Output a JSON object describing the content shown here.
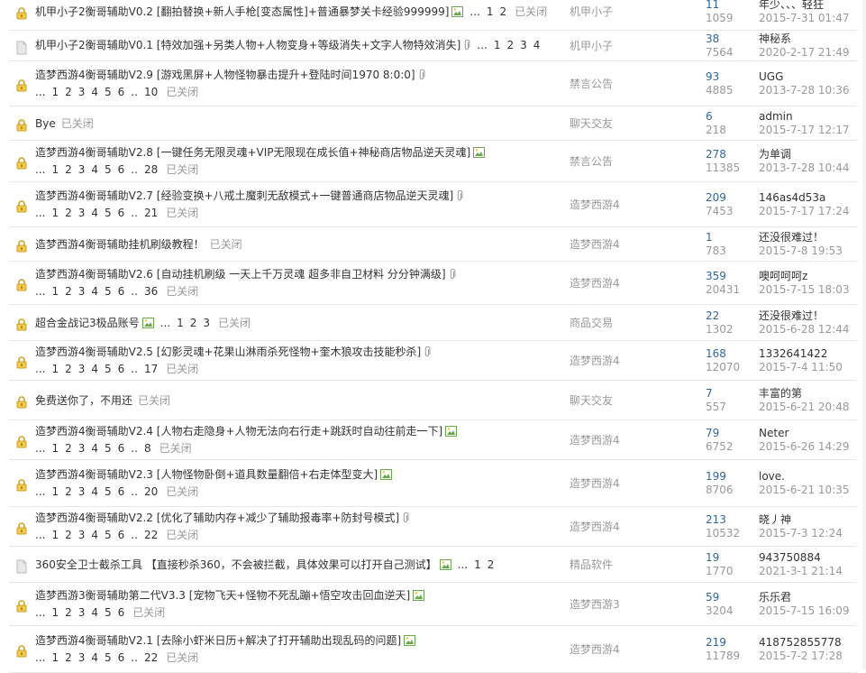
{
  "rows": [
    {
      "icon": "lock-icon",
      "title": "机甲小子2衡哥辅助V0.2",
      "desc": "[翻拍替换+新人手枪[变态属性]+普通暴梦关卡经验999999]",
      "badge": "image-attachment-icon",
      "pages": [
        "...",
        "1",
        "2"
      ],
      "closed": "已关闭",
      "forum": "机甲小子",
      "replies": "11",
      "views": "1059",
      "author": "年少、、、轻狂",
      "time": "2015-7-31 01:47"
    },
    {
      "icon": "document-icon",
      "title": "机甲小子2衡哥辅助V0.1",
      "desc": "[特效加强+另类人物+人物变身+等级消失+文字人物特效消失]",
      "badge": "paperclip-icon",
      "pages": [
        "...",
        "1",
        "2",
        "3",
        "4"
      ],
      "closed": "",
      "forum": "机甲小子",
      "replies": "38",
      "views": "7564",
      "author": "神秘系",
      "time": "2020-2-17 21:49"
    },
    {
      "icon": "lock-icon",
      "title": "造梦西游4衡哥辅助V2.9",
      "desc": "[游戏黑屏+人物怪物暴击提升+登陆时间1970 8:0:0]",
      "badge": "paperclip-icon",
      "pages": [
        "...",
        "1",
        "2",
        "3",
        "4",
        "5",
        "6",
        "..",
        "10"
      ],
      "closed": "已关闭",
      "forum": "禁言公告",
      "replies": "93",
      "views": "4885",
      "author": "UGG",
      "time": "2013-7-28 10:36"
    },
    {
      "icon": "lock-icon",
      "title": "Bye",
      "desc": "",
      "badge": "",
      "pages": [],
      "closed": "已关闭",
      "forum": "聊天交友",
      "replies": "6",
      "views": "218",
      "author": "admin",
      "time": "2015-7-17 12:17"
    },
    {
      "icon": "lock-icon",
      "title": "造梦西游4衡哥辅助V2.8",
      "desc": "[一键任务无限灵魂+VIP无限现在成长值+神秘商店物品逆天灵魂]",
      "badge": "image-attachment-icon",
      "pages": [
        "...",
        "1",
        "2",
        "3",
        "4",
        "5",
        "6",
        "..",
        "28"
      ],
      "closed": "已关闭",
      "forum": "禁言公告",
      "replies": "278",
      "views": "11385",
      "author": "为单调",
      "time": "2013-7-28 10:44"
    },
    {
      "icon": "lock-icon",
      "title": "造梦西游4衡哥辅助V2.7",
      "desc": "[经验变换+八戒土魔刺无敌模式+一键普通商店物品逆天灵魂]",
      "badge": "paperclip-icon",
      "pages": [
        "...",
        "1",
        "2",
        "3",
        "4",
        "5",
        "6",
        "..",
        "21"
      ],
      "closed": "已关闭",
      "forum": "造梦西游4",
      "replies": "209",
      "views": "7453",
      "author": "146as4d53a",
      "time": "2015-7-17 17:24"
    },
    {
      "icon": "lock-icon",
      "title": "造梦西游4衡哥辅助挂机刷级教程！",
      "desc": "",
      "badge": "",
      "pages": [],
      "closed": "已关闭",
      "forum": "造梦西游4",
      "replies": "1",
      "views": "783",
      "author": "还没很难过！",
      "time": "2015-7-8 19:53"
    },
    {
      "icon": "lock-icon",
      "title": "造梦西游4衡哥辅助V2.6",
      "desc": "[自动挂机刷级 一天上千万灵魂 超多非自卫材料 分分钟满级]",
      "badge": "paperclip-icon",
      "pages": [
        "...",
        "1",
        "2",
        "3",
        "4",
        "5",
        "6",
        "..",
        "36"
      ],
      "closed": "已关闭",
      "forum": "造梦西游4",
      "replies": "359",
      "views": "20431",
      "author": "噢呵呵呵z",
      "time": "2015-7-15 18:03"
    },
    {
      "icon": "lock-icon",
      "title": "超合金战记3极品账号",
      "desc": "",
      "badge": "image-attachment-icon",
      "pages": [
        "...",
        "1",
        "2",
        "3"
      ],
      "closed": "已关闭",
      "forum": "商品交易",
      "replies": "22",
      "views": "1302",
      "author": "还没很难过！",
      "time": "2015-6-28 12:44"
    },
    {
      "icon": "lock-icon",
      "title": "造梦西游4衡哥辅助V2.5",
      "desc": "[幻影灵魂+花果山淋雨杀死怪物+奎木狼攻击技能秒杀]",
      "badge": "paperclip-icon",
      "pages": [
        "...",
        "1",
        "2",
        "3",
        "4",
        "5",
        "6",
        "..",
        "17"
      ],
      "closed": "已关闭",
      "forum": "造梦西游4",
      "replies": "168",
      "views": "12070",
      "author": "1332641422",
      "time": "2015-7-4 11:50"
    },
    {
      "icon": "lock-icon",
      "title": "免费送你了，不用还",
      "desc": "",
      "badge": "",
      "pages": [],
      "closed": "已关闭",
      "forum": "聊天交友",
      "replies": "7",
      "views": "557",
      "author": "丰富的第",
      "time": "2015-6-21 20:48"
    },
    {
      "icon": "lock-icon",
      "title": "造梦西游4衡哥辅助V2.4",
      "desc": "[人物右走隐身+人物无法向右行走+跳跃时自动往前走一下]",
      "badge": "image-attachment-icon",
      "pages": [
        "...",
        "1",
        "2",
        "3",
        "4",
        "5",
        "6",
        "..",
        "8"
      ],
      "closed": "已关闭",
      "forum": "造梦西游4",
      "replies": "79",
      "views": "6752",
      "author": "Neter",
      "time": "2015-6-26 14:29"
    },
    {
      "icon": "lock-icon",
      "title": "造梦西游4衡哥辅助V2.3",
      "desc": "[人物怪物卧倒+道具数量翻倍+右走体型变大]",
      "badge": "image-attachment-icon",
      "pages": [
        "...",
        "1",
        "2",
        "3",
        "4",
        "5",
        "6",
        "..",
        "20"
      ],
      "closed": "已关闭",
      "forum": "造梦西游4",
      "replies": "199",
      "views": "8706",
      "author": "love.",
      "time": "2015-6-21 10:35"
    },
    {
      "icon": "lock-icon",
      "title": "造梦西游4衡哥辅助V2.2",
      "desc": "[优化了辅助内存+减少了辅助报毒率+防封号模式]",
      "badge": "paperclip-icon",
      "pages": [
        "...",
        "1",
        "2",
        "3",
        "4",
        "5",
        "6",
        "..",
        "22"
      ],
      "closed": "已关闭",
      "forum": "造梦西游4",
      "replies": "213",
      "views": "10532",
      "author": "晓丿神",
      "time": "2015-7-3 12:24"
    },
    {
      "icon": "document-icon",
      "title": "360安全卫士截杀工具",
      "desc": "【直接秒杀360，不会被拦截，具体效果可以打开自己测试】",
      "badge": "image-attachment-icon",
      "pages": [
        "...",
        "1",
        "2"
      ],
      "closed": "",
      "forum": "精品软件",
      "replies": "19",
      "views": "1770",
      "author": "943750884",
      "time": "2021-3-1 21:14"
    },
    {
      "icon": "lock-icon",
      "title": "造梦西游3衡哥辅助第二代V3.3",
      "desc": "[宠物飞天+怪物不死乱蹦+悟空攻击回血逆天]",
      "badge": "image-attachment-icon",
      "pages": [
        "...",
        "1",
        "2",
        "3",
        "4",
        "5",
        "6"
      ],
      "closed": "已关闭",
      "forum": "造梦西游3",
      "replies": "59",
      "views": "3204",
      "author": "乐乐君",
      "time": "2015-7-15 16:09"
    },
    {
      "icon": "lock-icon",
      "title": "造梦西游4衡哥辅助V2.1",
      "desc": "[去除小虾米日历+解决了打开辅助出现乱码的问题]",
      "badge": "image-attachment-icon",
      "pages": [
        "...",
        "1",
        "2",
        "3",
        "4",
        "5",
        "6",
        "..",
        "22"
      ],
      "closed": "已关闭",
      "forum": "造梦西游4",
      "replies": "219",
      "views": "11789",
      "author": "418752855778",
      "time": "2015-7-2 17:28"
    }
  ]
}
